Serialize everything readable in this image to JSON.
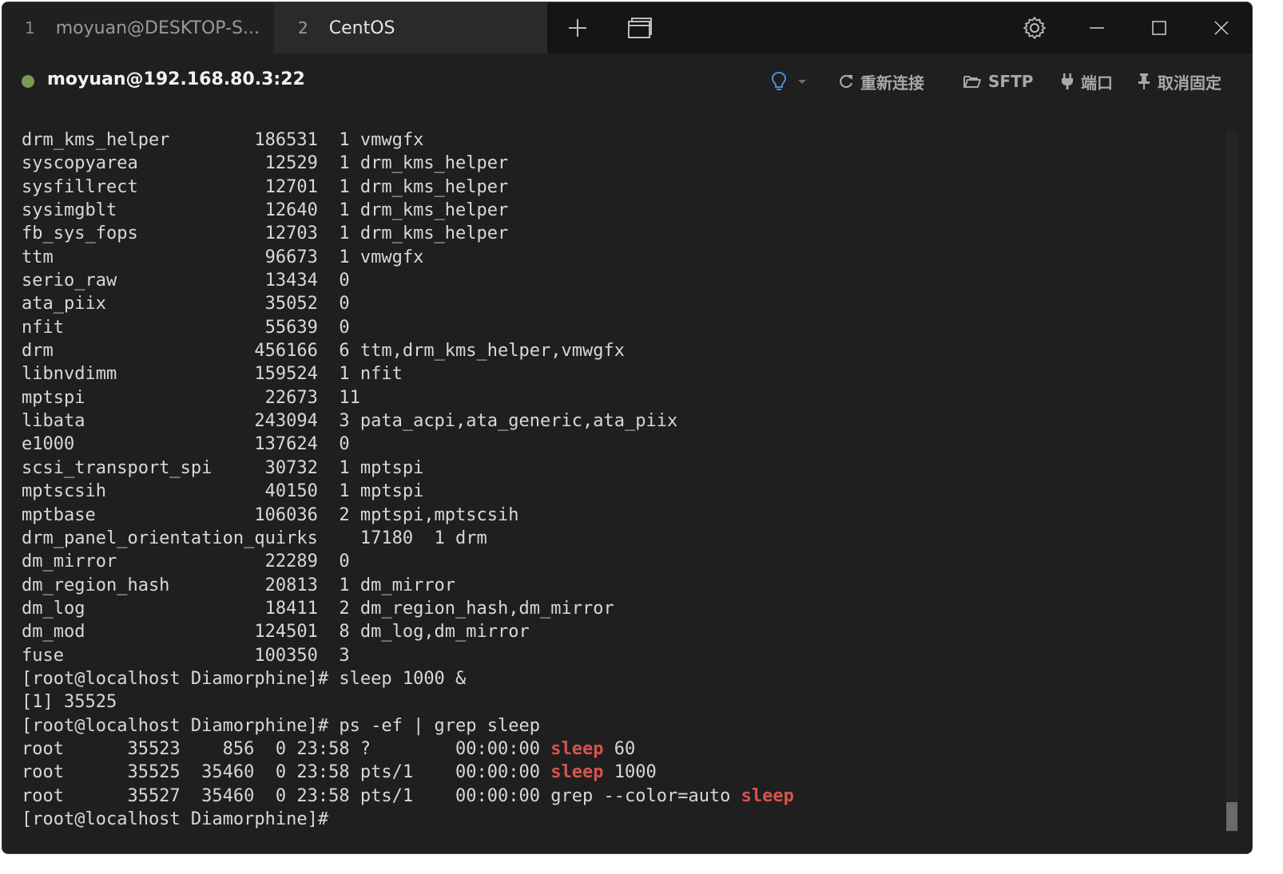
{
  "tabs": [
    {
      "num": "1",
      "label": "moyuan@DESKTOP-S..."
    },
    {
      "num": "2",
      "label": "CentOS"
    }
  ],
  "tabbar_icons": [
    "plus-icon",
    "window-layout-icon",
    "gear-icon",
    "minimize-icon",
    "maximize-icon",
    "close-icon"
  ],
  "session": {
    "status_color": "#7a9a52",
    "host": "moyuan@192.168.80.3:22",
    "toolbar": {
      "reconnect": "重新连接",
      "sftp": "SFTP",
      "port": "端口",
      "unpin": "取消固定"
    }
  },
  "colors": {
    "highlight": "#d9524f",
    "terminal_bg": "#1f1f1f",
    "terminal_fg": "#d8d8d8"
  },
  "terminal": {
    "lines": [
      "drm_kms_helper        186531  1 vmwgfx",
      "syscopyarea            12529  1 drm_kms_helper",
      "sysfillrect            12701  1 drm_kms_helper",
      "sysimgblt              12640  1 drm_kms_helper",
      "fb_sys_fops            12703  1 drm_kms_helper",
      "ttm                    96673  1 vmwgfx",
      "serio_raw              13434  0",
      "ata_piix               35052  0",
      "nfit                   55639  0",
      "drm                   456166  6 ttm,drm_kms_helper,vmwgfx",
      "libnvdimm             159524  1 nfit",
      "mptspi                 22673  11",
      "libata                243094  3 pata_acpi,ata_generic,ata_piix",
      "e1000                 137624  0",
      "scsi_transport_spi     30732  1 mptspi",
      "mptscsih               40150  1 mptspi",
      "mptbase               106036  2 mptspi,mptscsih",
      "drm_panel_orientation_quirks    17180  1 drm",
      "dm_mirror              22289  0",
      "dm_region_hash         20813  1 dm_mirror",
      "dm_log                 18411  2 dm_region_hash,dm_mirror",
      "dm_mod                124501  8 dm_log,dm_mirror",
      "fuse                  100350  3",
      "[root@localhost Diamorphine]# sleep 1000 &",
      "[1] 35525",
      "[root@localhost Diamorphine]# ps -ef | grep sleep"
    ],
    "ps_rows": [
      {
        "pre": "root      35523    856  0 23:58 ?        00:00:00 ",
        "hl": "sleep",
        "post": " 60"
      },
      {
        "pre": "root      35525  35460  0 23:58 pts/1    00:00:00 ",
        "hl": "sleep",
        "post": " 1000"
      },
      {
        "pre": "root      35527  35460  0 23:58 pts/1    00:00:00 grep --color=auto ",
        "hl": "sleep",
        "post": ""
      }
    ],
    "prompt": "[root@localhost Diamorphine]#"
  }
}
